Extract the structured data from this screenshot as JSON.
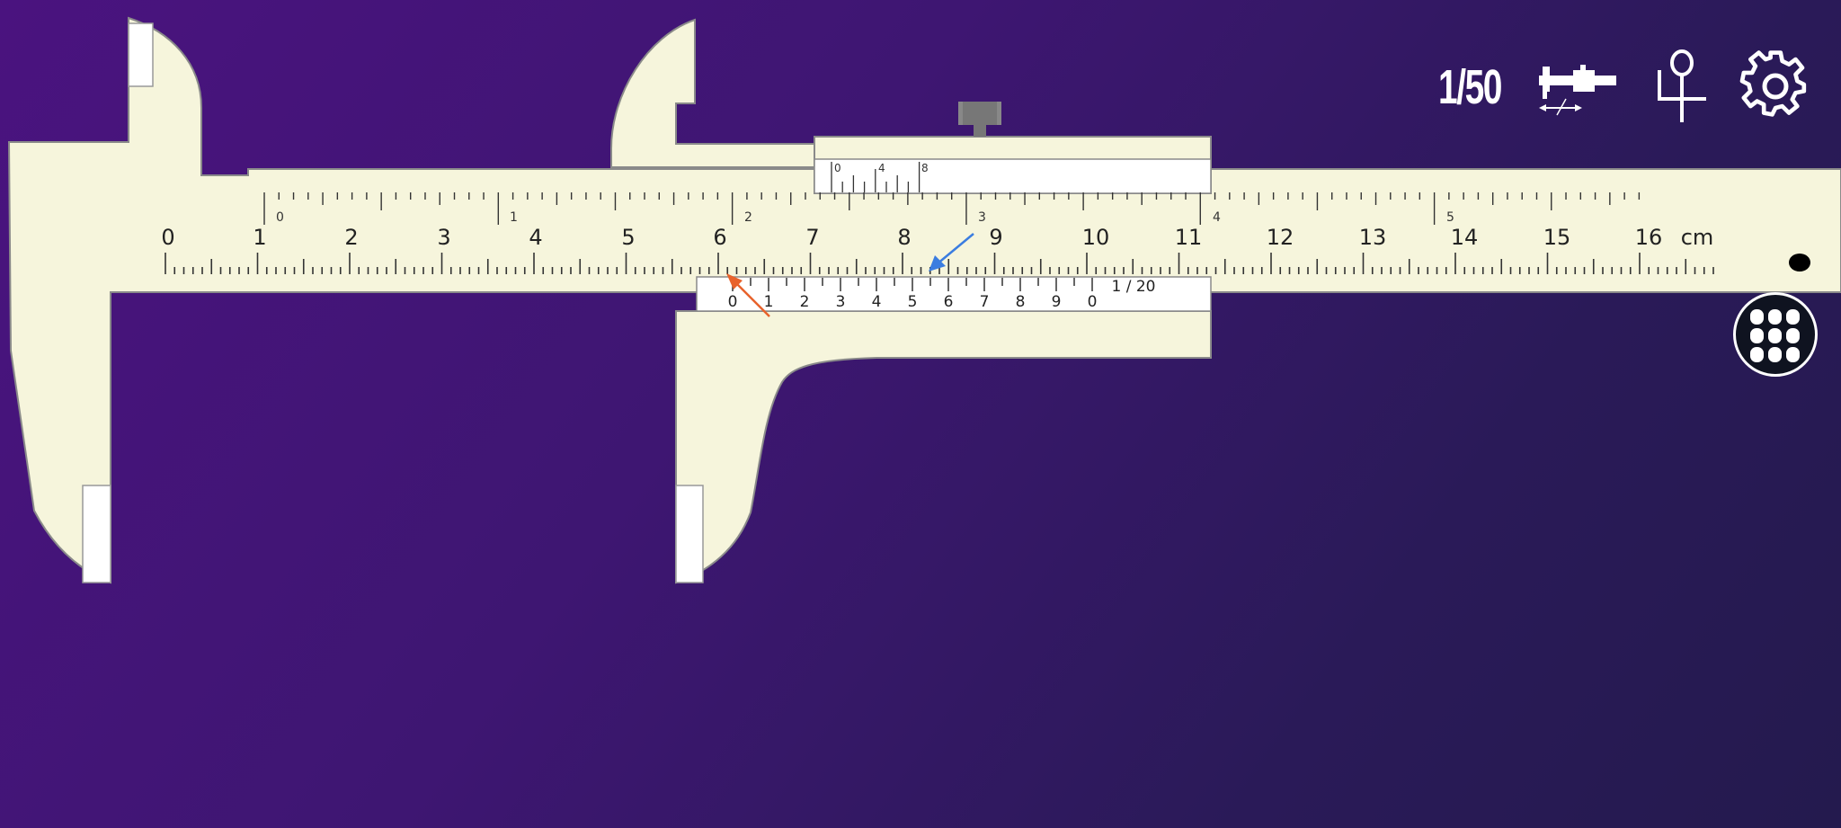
{
  "toolbar": {
    "precision_label": "1/50",
    "caliper_mode_icon": "caliper-icon",
    "depth_mode_icon": "depth-gauge-icon",
    "settings_icon": "gear-icon"
  },
  "menu_button_icon": "grid-dots-icon",
  "main_scale": {
    "cm_labels": [
      "0",
      "1",
      "2",
      "3",
      "4",
      "5",
      "6",
      "7",
      "8",
      "9",
      "10",
      "11",
      "12",
      "13",
      "14",
      "15",
      "16"
    ],
    "unit_label": "cm"
  },
  "inch_scale": {
    "labels": [
      "0",
      "1",
      "2",
      "3",
      "4",
      "5"
    ]
  },
  "vernier_scale": {
    "labels": [
      "0",
      "1",
      "2",
      "3",
      "4",
      "5",
      "6",
      "7",
      "8",
      "9",
      "0"
    ],
    "resolution_label": "1 / 20"
  },
  "inch_vernier": {
    "labels": [
      "0",
      "4",
      "8"
    ]
  },
  "colors": {
    "body": "#f6f5dc",
    "vernier_window": "#ffffff",
    "outline": "#7a7a7a",
    "arrow_orange": "#e8622b",
    "arrow_blue": "#3b7de0",
    "background": "#3e1672"
  }
}
